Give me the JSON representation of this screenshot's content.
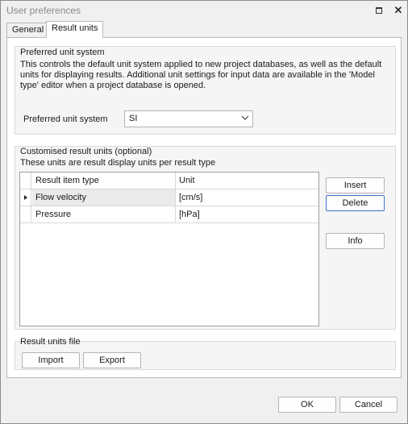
{
  "window": {
    "title": "User preferences",
    "restore_icon": "restore-icon",
    "close_glyph": "✕"
  },
  "tabs": [
    {
      "label": "General",
      "active": false
    },
    {
      "label": "Result units",
      "active": true
    }
  ],
  "preferred": {
    "group_title": "Preferred unit system",
    "description": "This controls the default unit system applied to new project databases, as well as the default units for displaying results. Additional unit settings for input data are available in the 'Model type' editor when a project database is opened.",
    "field_label": "Preferred unit system",
    "selected_value": "SI"
  },
  "custom": {
    "group_title": "Customised result units (optional)",
    "description": "These units are result display units per result type",
    "columns": [
      "Result item type",
      "Unit"
    ],
    "rows": [
      {
        "type": "Flow velocity",
        "unit": "[cm/s]",
        "current": true
      },
      {
        "type": "Pressure",
        "unit": "[hPa]",
        "current": false
      }
    ],
    "buttons": {
      "insert": "Insert",
      "delete": "Delete",
      "info": "Info"
    }
  },
  "file": {
    "group_title": "Result units file",
    "import_label": "Import",
    "export_label": "Export"
  },
  "footer": {
    "ok_label": "OK",
    "cancel_label": "Cancel"
  },
  "colors": {
    "focus_border": "#3d72c8",
    "window_bg": "#f0f0f0"
  }
}
